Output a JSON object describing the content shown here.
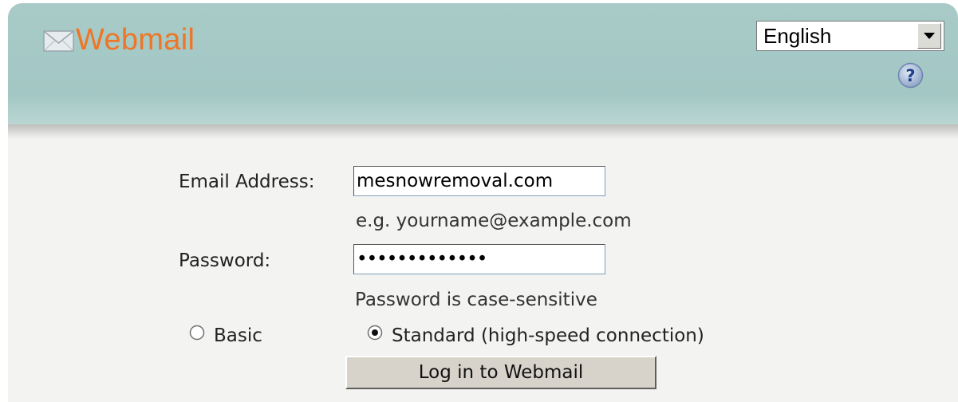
{
  "header": {
    "logo_text": "Webmail",
    "language": {
      "selected": "English"
    },
    "help_icon": "question-circle-icon"
  },
  "login_form": {
    "email_label": "Email Address:",
    "email_value": "mesnowremoval.com",
    "email_hint": "e.g. yourname@example.com",
    "password_label": "Password:",
    "password_value": "•••••••••••••",
    "password_hint": "Password is case-sensitive",
    "mode_options": [
      {
        "label": "Basic",
        "selected": false
      },
      {
        "label": "Standard (high-speed connection)",
        "selected": true
      }
    ],
    "submit_label": "Log in to Webmail"
  },
  "colors": {
    "header_bg": "#a5c9c6",
    "logo_orange": "#ee7626",
    "panel_bg": "#f3f3f1"
  }
}
